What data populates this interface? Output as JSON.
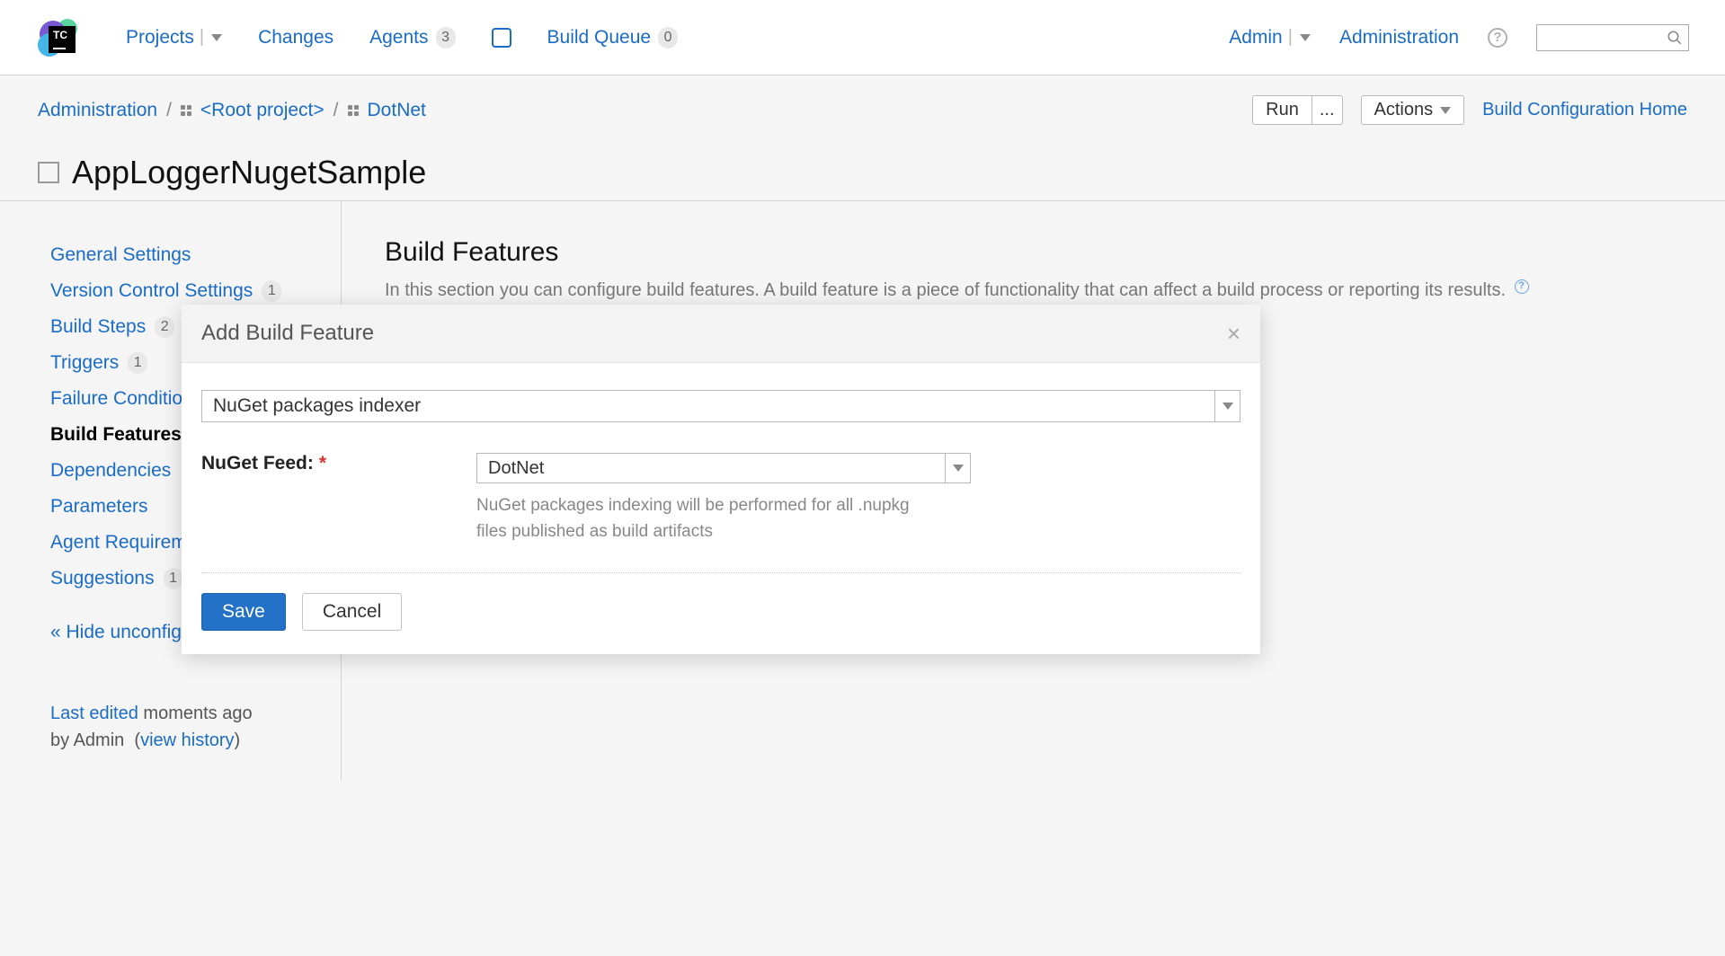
{
  "nav": {
    "projects": "Projects",
    "changes": "Changes",
    "agents": "Agents",
    "agents_count": "3",
    "build_queue": "Build Queue",
    "build_queue_count": "0",
    "admin": "Admin",
    "administration": "Administration"
  },
  "breadcrumb": {
    "administration": "Administration",
    "root_project": "<Root project>",
    "project": "DotNet"
  },
  "header_actions": {
    "run": "Run",
    "run_more": "...",
    "actions": "Actions",
    "config_home": "Build Configuration Home"
  },
  "page_title": "AppLoggerNugetSample",
  "sidebar": {
    "items": [
      {
        "label": "General Settings",
        "badge": null,
        "active": false
      },
      {
        "label": "Version Control Settings",
        "badge": "1",
        "active": false
      },
      {
        "label": "Build Steps",
        "badge": "2",
        "active": false
      },
      {
        "label": "Triggers",
        "badge": "1",
        "active": false
      },
      {
        "label": "Failure Conditions",
        "badge": null,
        "active": false
      },
      {
        "label": "Build Features",
        "badge": null,
        "active": true
      },
      {
        "label": "Dependencies",
        "badge": null,
        "active": false
      },
      {
        "label": "Parameters",
        "badge": null,
        "active": false
      },
      {
        "label": "Agent Requirements",
        "badge": null,
        "active": false
      },
      {
        "label": "Suggestions",
        "badge": "1",
        "active": false
      }
    ],
    "hide_unconfig": "« Hide unconfigured",
    "meta_prefix": "Last edited",
    "meta_when": " moments ago",
    "meta_by_prefix": "by ",
    "meta_by_user": "Admin",
    "meta_history": "view history"
  },
  "content": {
    "heading": "Build Features",
    "description": "In this section you can configure build features. A build feature is a piece of functionality that can affect a build process or reporting its results."
  },
  "dialog": {
    "title": "Add Build Feature",
    "feature_type": "NuGet packages indexer",
    "feed_label": "NuGet Feed:",
    "feed_value": "DotNet",
    "feed_help": "NuGet packages indexing will be performed for all .nupkg files published as build artifacts",
    "save": "Save",
    "cancel": "Cancel"
  }
}
